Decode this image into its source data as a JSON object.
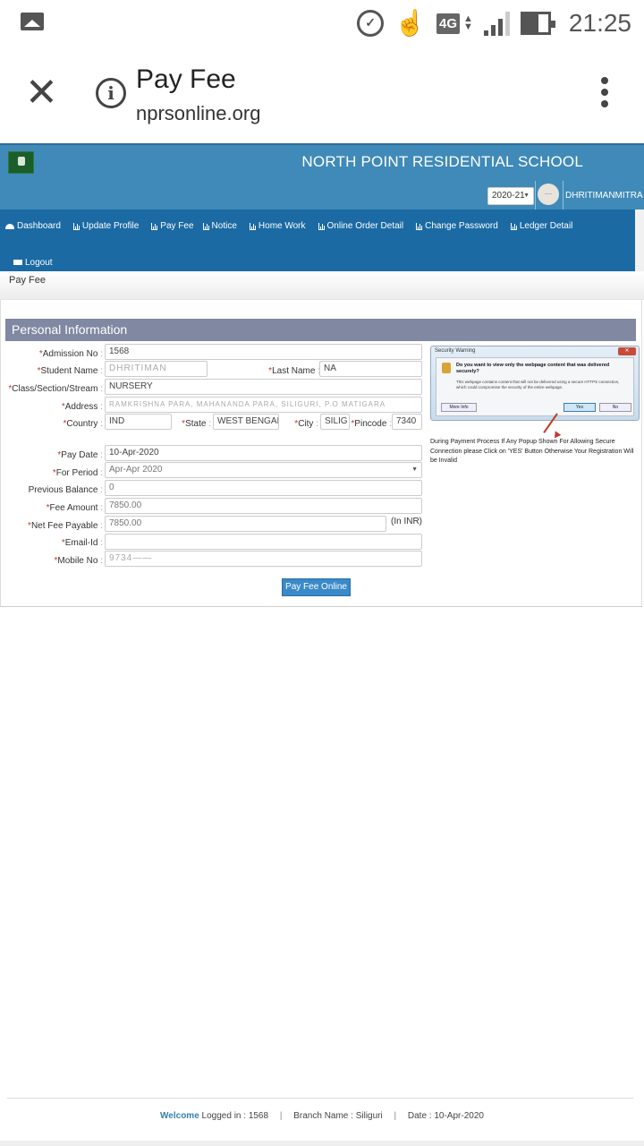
{
  "status_bar": {
    "time": "21:25",
    "network": "4G",
    "icons": [
      "image-icon",
      "alarm-icon",
      "touch-icon",
      "4g-icon",
      "signal-icon",
      "battery-icon"
    ]
  },
  "browser": {
    "page_title": "Pay Fee",
    "url": "nprsonline.org",
    "close_icon": "close-icon",
    "info_icon": "info-icon",
    "menu_icon": "more-vert-icon"
  },
  "header": {
    "school_name": "NORTH POINT RESIDENTIAL SCHOOL",
    "session_select": "2020-21",
    "username": "DHRITIMANMITRA"
  },
  "nav": {
    "items": [
      {
        "label": "Dashboard",
        "icon": "dashboard-icon"
      },
      {
        "label": "Update Profile",
        "icon": "bar-chart-icon"
      },
      {
        "label": "Pay Fee",
        "icon": "bar-chart-icon"
      },
      {
        "label": "Notice",
        "icon": "bar-chart-icon"
      },
      {
        "label": "Home Work",
        "icon": "bar-chart-icon"
      },
      {
        "label": "Online Order Detail",
        "icon": "bar-chart-icon"
      },
      {
        "label": "Change Password",
        "icon": "bar-chart-icon"
      },
      {
        "label": "Ledger Detail",
        "icon": "bar-chart-icon"
      }
    ],
    "logout": {
      "label": "Logout",
      "icon": "laptop-icon"
    }
  },
  "breadcrumb": "Pay Fee",
  "form": {
    "section_title": "Personal Information",
    "fields": {
      "admission_no": {
        "label": "Admission No",
        "value": "1568",
        "required": true
      },
      "student_name": {
        "label": "Student Name",
        "value": "DHRITIMAN",
        "required": true
      },
      "last_name": {
        "label": "Last Name",
        "value": "NA",
        "required": true
      },
      "class": {
        "label": "Class/Section/Stream",
        "value": "NURSERY",
        "required": true
      },
      "address": {
        "label": "Address",
        "value": "RAMKRISHNA PARA, MAHANANDA PARA, SILIGURI, P.O MATIGARA",
        "required": true
      },
      "country": {
        "label": "Country",
        "value": "IND",
        "required": true
      },
      "state": {
        "label": "State",
        "value": "WEST BENGAI",
        "required": true
      },
      "city": {
        "label": "City",
        "value": "SILIG",
        "required": true
      },
      "pincode": {
        "label": "Pincode",
        "value": "7340",
        "required": true
      },
      "pay_date": {
        "label": "Pay Date",
        "value": "10-Apr-2020",
        "required": true
      },
      "for_period": {
        "label": "For Period",
        "value": "Apr-Apr 2020",
        "required": true
      },
      "previous_balance": {
        "label": "Previous Balance",
        "value": "0",
        "required": false
      },
      "fee_amount": {
        "label": "Fee Amount",
        "value": "7850.00",
        "required": true
      },
      "net_fee_payable": {
        "label": "Net Fee Payable",
        "value": "7850.00",
        "required": true,
        "unit": "(In INR)"
      },
      "email": {
        "label": "Email-Id",
        "value": "",
        "required": true
      },
      "mobile": {
        "label": "Mobile No",
        "value": "9734——",
        "required": true
      }
    },
    "submit_label": "Pay Fee Online"
  },
  "security_notice": {
    "dialog_title": "Security Warning",
    "question": "Do you want to view only the webpage content that was delivered securely?",
    "description": "This webpage contains content that will not be delivered using a secure HTTPS connection, which could compromise the security of the entire webpage.",
    "more_info": "More Info",
    "yes": "Yes",
    "no": "No",
    "note": "During Payment Process If Any Popup Shown For Allowing Secure Connection please Click on 'YES' Button Otherwise Your Registration Will be Invalid"
  },
  "footer": {
    "welcome": "Welcome",
    "logged_in": "Logged in : 1568",
    "branch": "Branch Name : Siliguri",
    "date": "Date : 10-Apr-2020"
  }
}
